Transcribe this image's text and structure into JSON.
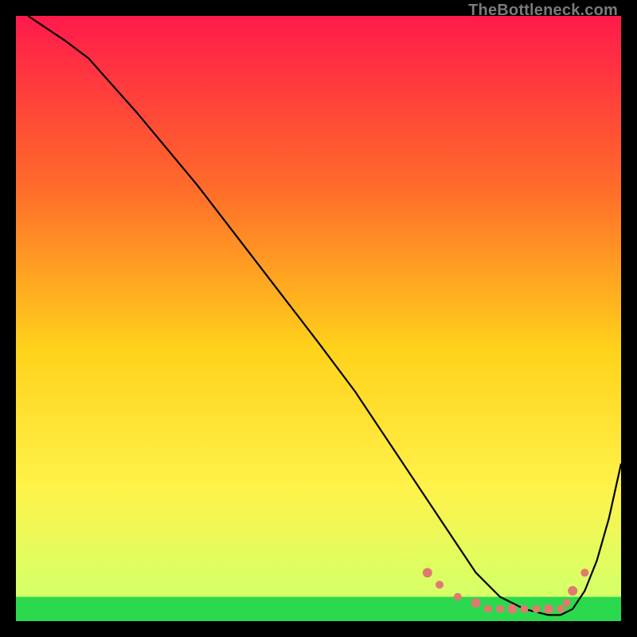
{
  "watermark": "TheBottleneck.com",
  "colors": {
    "frame": "#000000",
    "curve": "#000000",
    "dots": "#e07a6f",
    "green_band": "#2bd94f",
    "gradient_top": "#ff1a4b",
    "gradient_mid1": "#ff6a2a",
    "gradient_mid2": "#ffd21a",
    "gradient_mid3": "#fff24a",
    "gradient_bottom": "#d8ff66"
  },
  "chart_data": {
    "type": "line",
    "title": "",
    "xlabel": "",
    "ylabel": "",
    "xlim": [
      0,
      100
    ],
    "ylim": [
      0,
      100
    ],
    "curve": {
      "x": [
        2,
        5,
        8,
        12,
        20,
        30,
        40,
        50,
        56,
        60,
        64,
        68,
        72,
        76,
        80,
        84,
        88,
        90,
        92,
        94,
        96,
        98,
        100
      ],
      "y": [
        100,
        98,
        96,
        93,
        84,
        72,
        59,
        46,
        38,
        32,
        26,
        20,
        14,
        8,
        4,
        2,
        1,
        1,
        2,
        5,
        10,
        17,
        26
      ]
    },
    "series": [
      {
        "name": "dot-cluster",
        "x": [
          68,
          70,
          73,
          76,
          78,
          80,
          82,
          84,
          86,
          88,
          90,
          91,
          92,
          94
        ],
        "y": [
          8,
          6,
          4,
          3,
          2,
          2,
          2,
          2,
          2,
          2,
          2,
          3,
          5,
          8
        ]
      }
    ],
    "green_band_y": [
      0,
      4
    ]
  }
}
